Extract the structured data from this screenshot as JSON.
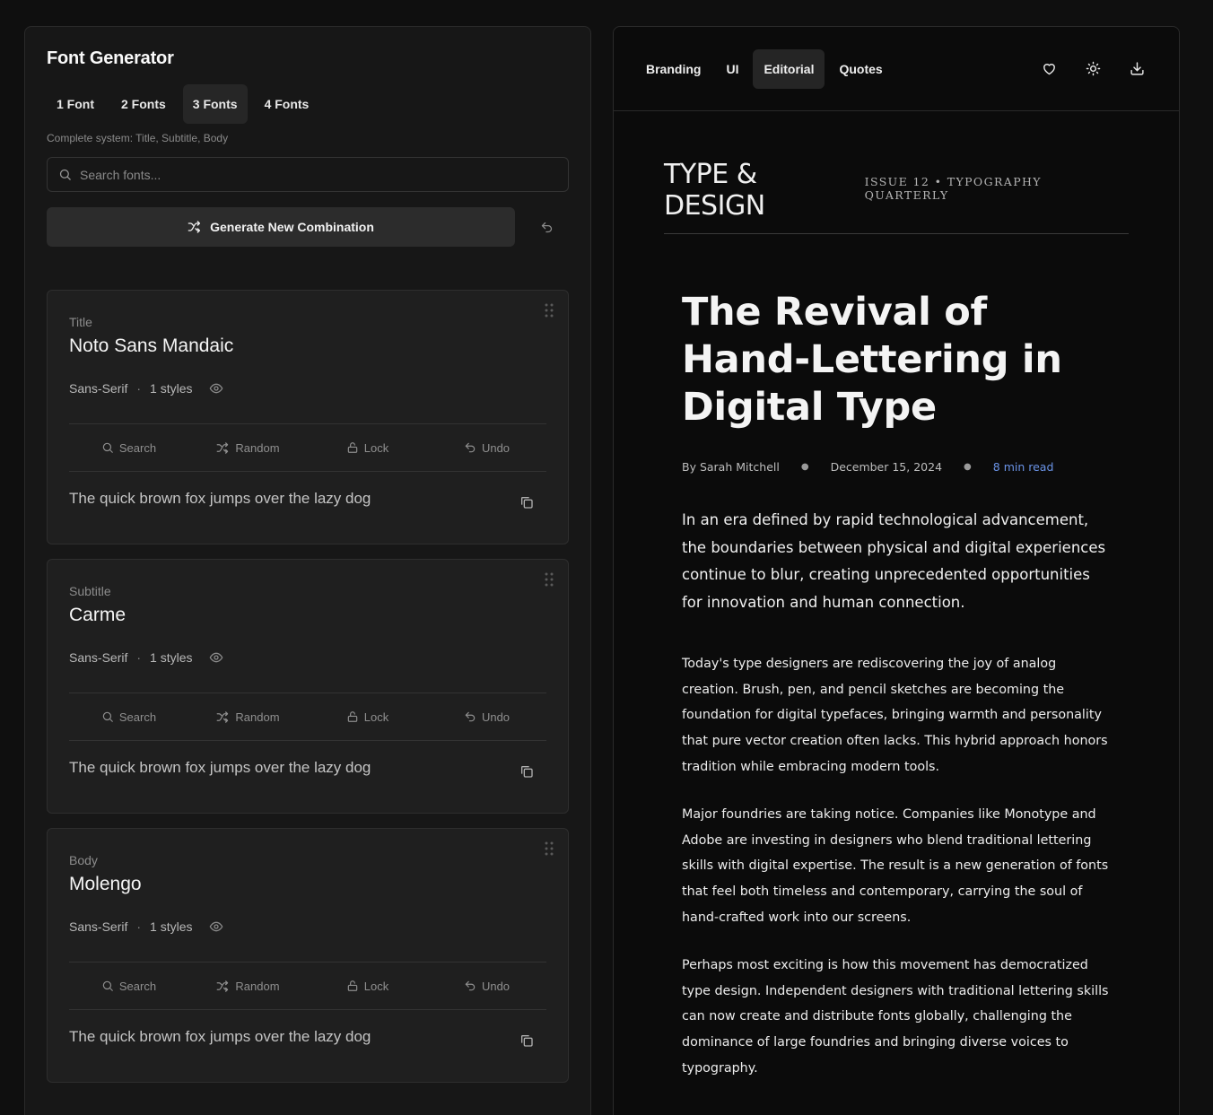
{
  "app": {
    "title": "Font Generator",
    "count_tabs": [
      "1 Font",
      "2 Fonts",
      "3 Fonts",
      "4 Fonts"
    ],
    "active_count_tab": "3 Fonts",
    "mode_description": "Complete system: Title, Subtitle, Body",
    "search": {
      "placeholder": "Search fonts...",
      "value": ""
    },
    "generate_label": "Generate New Combination"
  },
  "cards": [
    {
      "role": "Title",
      "font": "Noto Sans Mandaic",
      "category": "Sans-Serif",
      "styles": "1 styles",
      "actions": [
        "Search",
        "Random",
        "Lock",
        "Undo"
      ],
      "sample": "The quick brown fox jumps over the lazy dog"
    },
    {
      "role": "Subtitle",
      "font": "Carme",
      "category": "Sans-Serif",
      "styles": "1 styles",
      "actions": [
        "Search",
        "Random",
        "Lock",
        "Undo"
      ],
      "sample": "The quick brown fox jumps over the lazy dog"
    },
    {
      "role": "Body",
      "font": "Molengo",
      "category": "Sans-Serif",
      "styles": "1 styles",
      "actions": [
        "Search",
        "Random",
        "Lock",
        "Undo"
      ],
      "sample": "The quick brown fox jumps over the lazy dog"
    }
  ],
  "preview": {
    "style_tabs": [
      "Branding",
      "UI",
      "Editorial",
      "Quotes"
    ],
    "active_style_tab": "Editorial",
    "header_icons": [
      "heart-icon",
      "sun-icon",
      "download-icon"
    ],
    "magazine": {
      "title": "TYPE & DESIGN",
      "issue": "ISSUE 12 • TYPOGRAPHY QUARTERLY"
    },
    "article": {
      "headline": "The Revival of Hand-Lettering in Digital Type",
      "author": "By Sarah Mitchell",
      "date": "December 15, 2024",
      "read_time": "8 min read",
      "lead": "In an era defined by rapid technological advancement, the boundaries between physical and digital experiences continue to blur, creating unprecedented opportunities for innovation and human connection.",
      "paragraphs": [
        "Today's type designers are rediscovering the joy of analog creation. Brush, pen, and pencil sketches are becoming the foundation for digital typefaces, bringing warmth and personality that pure vector creation often lacks. This hybrid approach honors tradition while embracing modern tools.",
        "Major foundries are taking notice. Companies like Monotype and Adobe are investing in designers who blend traditional lettering skills with digital expertise. The result is a new generation of fonts that feel both timeless and contemporary, carrying the soul of hand-crafted work into our screens.",
        "Perhaps most exciting is how this movement has democratized type design. Independent designers with traditional lettering skills can now create and distribute fonts globally, challenging the dominance of large foundries and bringing diverse voices to typography."
      ]
    }
  },
  "colors": {
    "accent_link": "#6a93e6",
    "panel_bg": "#171717",
    "card_bg": "#1f1f1f",
    "preview_bg": "#0b0b0b"
  }
}
